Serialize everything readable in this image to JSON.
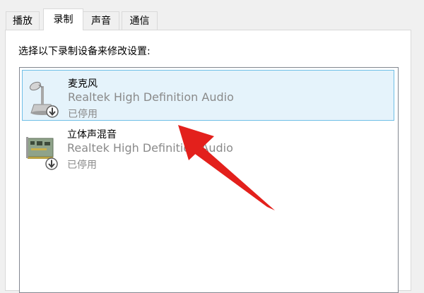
{
  "tabs": [
    "播放",
    "录制",
    "声音",
    "通信"
  ],
  "active_tab": "录制",
  "instruction": "选择以下录制设备来修改设置:",
  "devices": [
    {
      "name": "麦克风",
      "driver": "Realtek High Definition Audio",
      "status": "已停用",
      "icon": "microphone-icon",
      "status_icon": "disabled-down-arrow-icon",
      "selected": true
    },
    {
      "name": "立体声混音",
      "driver": "Realtek High Definition Audio",
      "status": "已停用",
      "icon": "sound-card-icon",
      "status_icon": "disabled-down-arrow-icon",
      "selected": false
    }
  ],
  "colors": {
    "selection_bg": "#e5f3fb",
    "selection_border": "#70c0e7",
    "annotation_arrow": "#e3201c",
    "secondary_text": "#8a8a8a"
  },
  "annotation": "red-arrow-pointing-to-microphone"
}
